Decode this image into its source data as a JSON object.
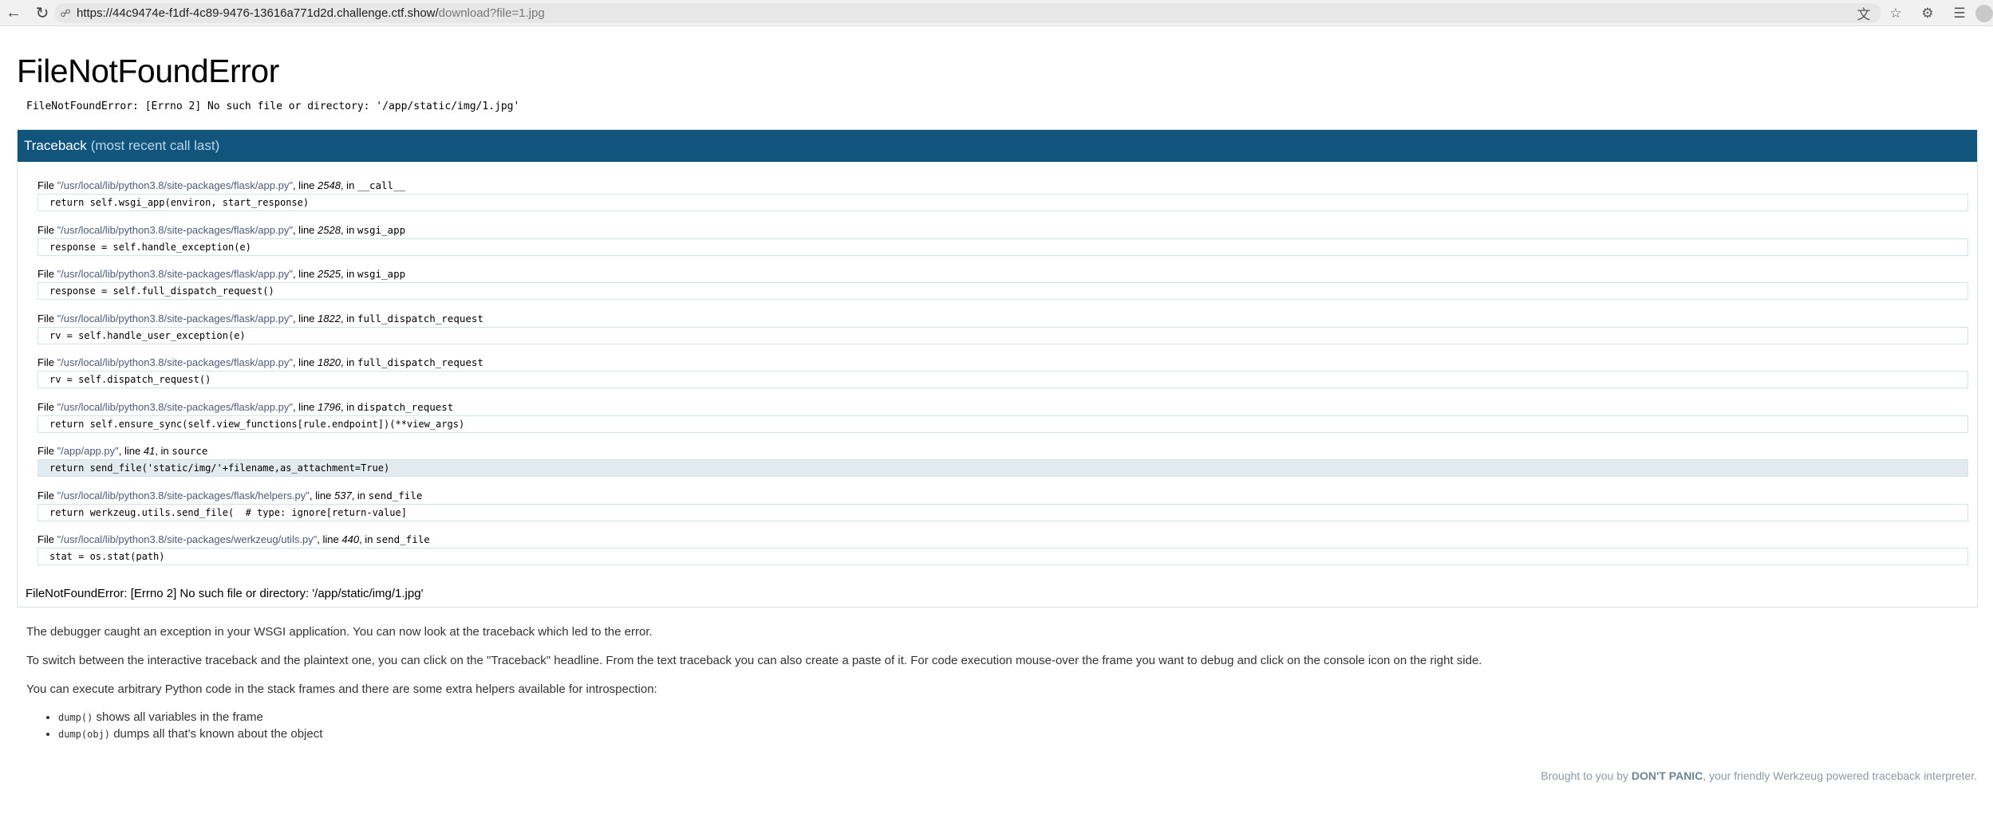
{
  "browser": {
    "url_main": "https://44c9474e-f1df-4c89-9476-13616a771d2d.challenge.ctf.show/",
    "url_rest": "download?file=1.jpg",
    "icons": [
      "back-icon",
      "reload-icon",
      "lock-icon",
      "translate-icon",
      "star-icon",
      "extensions-icon",
      "menu-icon"
    ]
  },
  "error": {
    "title": "FileNotFoundError",
    "message": "FileNotFoundError: [Errno 2] No such file or directory: '/app/static/img/1.jpg'"
  },
  "traceback": {
    "header": "Traceback",
    "header_sub": "(most recent call last)",
    "frames": [
      {
        "file": "\"/usr/local/lib/python3.8/site-packages/flask/app.py\"",
        "line": "2548",
        "func": "__call__",
        "code": "return self.wsgi_app(environ, start_response)"
      },
      {
        "file": "\"/usr/local/lib/python3.8/site-packages/flask/app.py\"",
        "line": "2528",
        "func": "wsgi_app",
        "code": "response = self.handle_exception(e)"
      },
      {
        "file": "\"/usr/local/lib/python3.8/site-packages/flask/app.py\"",
        "line": "2525",
        "func": "wsgi_app",
        "code": "response = self.full_dispatch_request()"
      },
      {
        "file": "\"/usr/local/lib/python3.8/site-packages/flask/app.py\"",
        "line": "1822",
        "func": "full_dispatch_request",
        "code": "rv = self.handle_user_exception(e)"
      },
      {
        "file": "\"/usr/local/lib/python3.8/site-packages/flask/app.py\"",
        "line": "1820",
        "func": "full_dispatch_request",
        "code": "rv = self.dispatch_request()"
      },
      {
        "file": "\"/usr/local/lib/python3.8/site-packages/flask/app.py\"",
        "line": "1796",
        "func": "dispatch_request",
        "code": "return self.ensure_sync(self.view_functions[rule.endpoint])(**view_args)"
      },
      {
        "file": "\"/app/app.py\"",
        "line": "41",
        "func": "source",
        "code": "return send_file('static/img/'+filename,as_attachment=True)"
      },
      {
        "file": "\"/usr/local/lib/python3.8/site-packages/flask/helpers.py\"",
        "line": "537",
        "func": "send_file",
        "code": "return werkzeug.utils.send_file(  # type: ignore[return-value]"
      },
      {
        "file": "\"/usr/local/lib/python3.8/site-packages/werkzeug/utils.py\"",
        "line": "440",
        "func": "send_file",
        "code": "stat = os.stat(path)"
      }
    ],
    "final_error": "FileNotFoundError: [Errno 2] No such file or directory: '/app/static/img/1.jpg'"
  },
  "labels": {
    "file": "File ",
    "line": ", line ",
    "in": ", in "
  },
  "explanation": {
    "p1": "The debugger caught an exception in your WSGI application. You can now look at the traceback which led to the error.",
    "p2": "To switch between the interactive traceback and the plaintext one, you can click on the \"Traceback\" headline. From the text traceback you can also create a paste of it. For code execution mouse-over the frame you want to debug and click on the console icon on the right side.",
    "p3": "You can execute arbitrary Python code in the stack frames and there are some extra helpers available for introspection:",
    "helpers": [
      {
        "code": "dump()",
        "text": " shows all variables in the frame"
      },
      {
        "code": "dump(obj)",
        "text": " dumps all that's known about the object"
      }
    ]
  },
  "footer": {
    "prefix": "Brought to you by ",
    "brand": "DON'T PANIC",
    "suffix": ", your friendly Werkzeug powered traceback interpreter."
  }
}
